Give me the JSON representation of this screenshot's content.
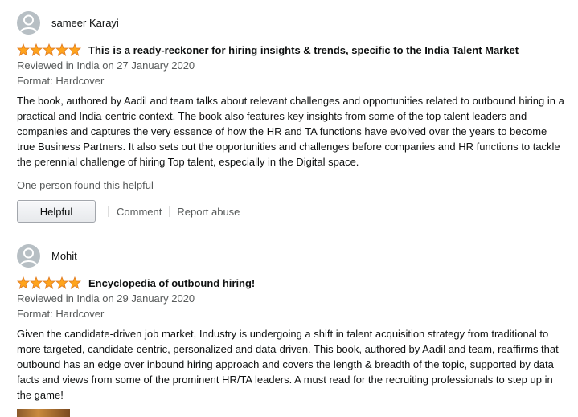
{
  "reviews": [
    {
      "reviewer": "sameer Karayi",
      "rating": 5,
      "title": "This is a ready-reckoner for hiring insights & trends, specific to the India Talent Market",
      "date": "Reviewed in India on 27 January 2020",
      "format": "Format: Hardcover",
      "body": "The book, authored by Aadil and team talks about relevant challenges and opportunities related to outbound hiring in a practical and India-centric context. The book also features key insights from some of the top talent leaders and companies and captures the very essence of how the HR and TA functions have evolved over the years to become true Business Partners. It also sets out the opportunities and challenges before companies and HR functions to tackle the perennial challenge of hiring Top talent, especially in the Digital space.",
      "helpful_count": "One person found this helpful",
      "helpful_label": "Helpful",
      "comment_label": "Comment",
      "report_label": "Report abuse"
    },
    {
      "reviewer": "Mohit",
      "rating": 5,
      "title": "Encyclopedia of outbound hiring!",
      "date": "Reviewed in India on 29 January 2020",
      "format": "Format: Hardcover",
      "body": "Given the candidate-driven job market, Industry is undergoing a shift in talent acquisition strategy from traditional to more targeted, candidate-centric, personalized and data-driven. This book, authored by Aadil and team, reaffirms that outbound has an edge over inbound hiring approach and covers the length & breadth of the topic, supported by data facts and views from some of the prominent HR/TA leaders. A must read for the recruiting professionals to step up in the game!"
    }
  ],
  "colors": {
    "star": "#ffa41c",
    "star_stroke": "#de7921",
    "muted_text": "#565959",
    "avatar_bg": "#b7bfc4"
  },
  "icons": {
    "avatar": "default-avatar-icon",
    "star": "star-icon"
  }
}
